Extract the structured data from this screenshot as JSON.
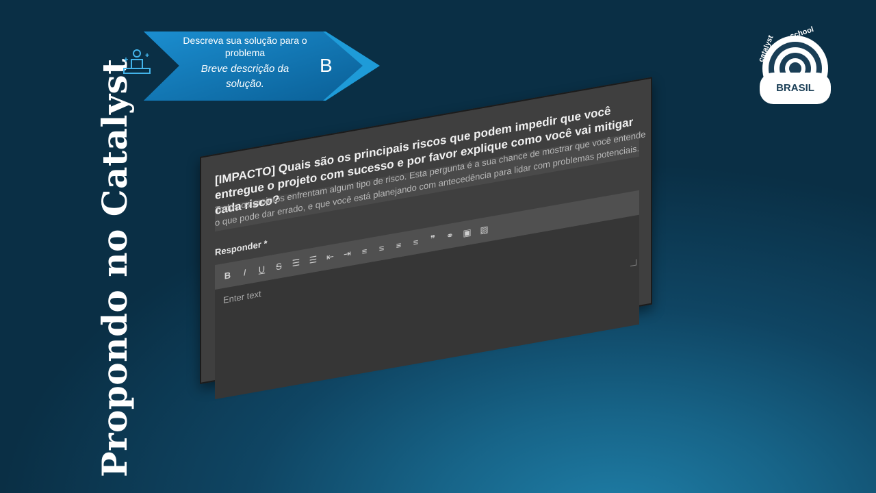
{
  "slide": {
    "title": "Propondo no Catalyst"
  },
  "step_banner": {
    "line1": "Descreva sua solução para o problema",
    "line2": "Breve descrição da solução.",
    "letter": "B"
  },
  "logo": {
    "text_catalyst": "catalyst",
    "text_school": "school",
    "text_brasil": "BRASIL"
  },
  "form": {
    "question": "[IMPACTO] Quais são os principais riscos que podem impedir que você entregue o projeto com sucesso e por favor explique como você vai mitigar cada risco?",
    "description": "Todos os projetos enfrentam algum tipo de risco. Esta pergunta é a sua chance de mostrar que você entende o que pode dar errado, e que você está planejando com antecedência para lidar com problemas potenciais.",
    "label": "Responder *",
    "placeholder": "Enter text",
    "toolbar": [
      {
        "name": "bold-button",
        "glyph": "B"
      },
      {
        "name": "italic-button",
        "glyph": "I"
      },
      {
        "name": "underline-button",
        "glyph": "U"
      },
      {
        "name": "strikethrough-button",
        "glyph": "S"
      },
      {
        "name": "bullet-list-button",
        "glyph": "☰"
      },
      {
        "name": "numbered-list-button",
        "glyph": "☰"
      },
      {
        "name": "outdent-button",
        "glyph": "⇤"
      },
      {
        "name": "indent-button",
        "glyph": "⇥"
      },
      {
        "name": "align-left-button",
        "glyph": "≡"
      },
      {
        "name": "align-center-button",
        "glyph": "≡"
      },
      {
        "name": "align-right-button",
        "glyph": "≡"
      },
      {
        "name": "justify-button",
        "glyph": "≡"
      },
      {
        "name": "quote-button",
        "glyph": "❞"
      },
      {
        "name": "link-button",
        "glyph": "⚭"
      },
      {
        "name": "video-button",
        "glyph": "▣"
      },
      {
        "name": "image-button",
        "glyph": "▨"
      }
    ]
  }
}
